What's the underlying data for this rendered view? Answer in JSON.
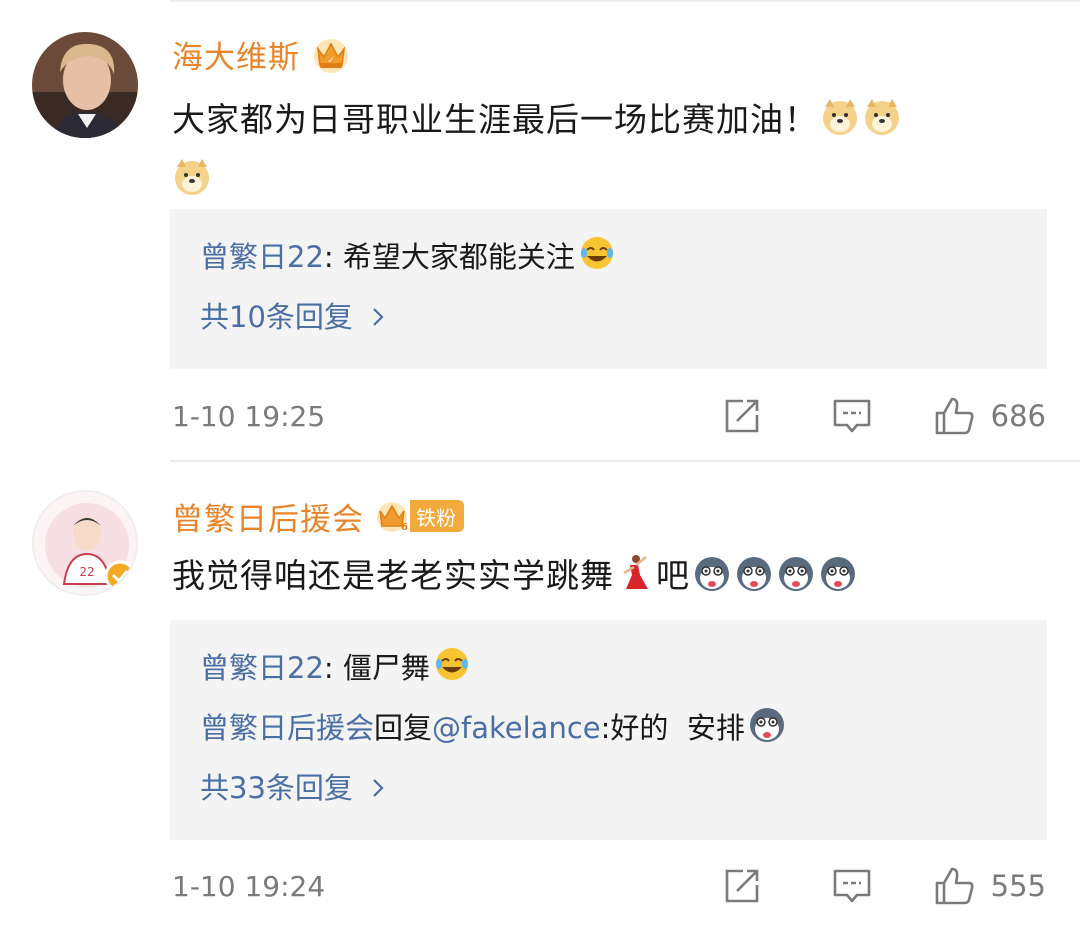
{
  "comments": [
    {
      "username": "海大维斯",
      "text": "大家都为日哥职业生涯最后一场比赛加油！",
      "replies": [
        {
          "user": "曾繁日22",
          "sep": ": ",
          "text": "希望大家都能关注"
        }
      ],
      "more": "共10条回复",
      "time": "1-10 19:25",
      "likes": "686"
    },
    {
      "username": "曾繁日后援会",
      "fan_label": "铁粉",
      "text_before": "我觉得咱还是老老实实学跳舞",
      "text_after": "吧",
      "replies": [
        {
          "user": "曾繁日22",
          "sep": ": ",
          "text": "僵尸舞"
        },
        {
          "user": "曾繁日后援会",
          "mid": "回复",
          "at": "@fakelance",
          "sep": ":",
          "text": "好的  安排"
        }
      ],
      "more": "共33条回复",
      "time": "1-10 19:24",
      "likes": "555"
    }
  ],
  "colors": {
    "username": "#e8852b",
    "link": "#4a6fa5",
    "meta": "#7a7a7a",
    "reply_bg": "#f4f4f4"
  },
  "icons": [
    "crown-icon",
    "doge-emoji-icon",
    "laugh-cry-emoji-icon",
    "dancer-emoji-icon",
    "husky-emoji-icon",
    "share-icon",
    "comment-icon",
    "like-icon",
    "chevron-right-icon",
    "verified-icon"
  ]
}
